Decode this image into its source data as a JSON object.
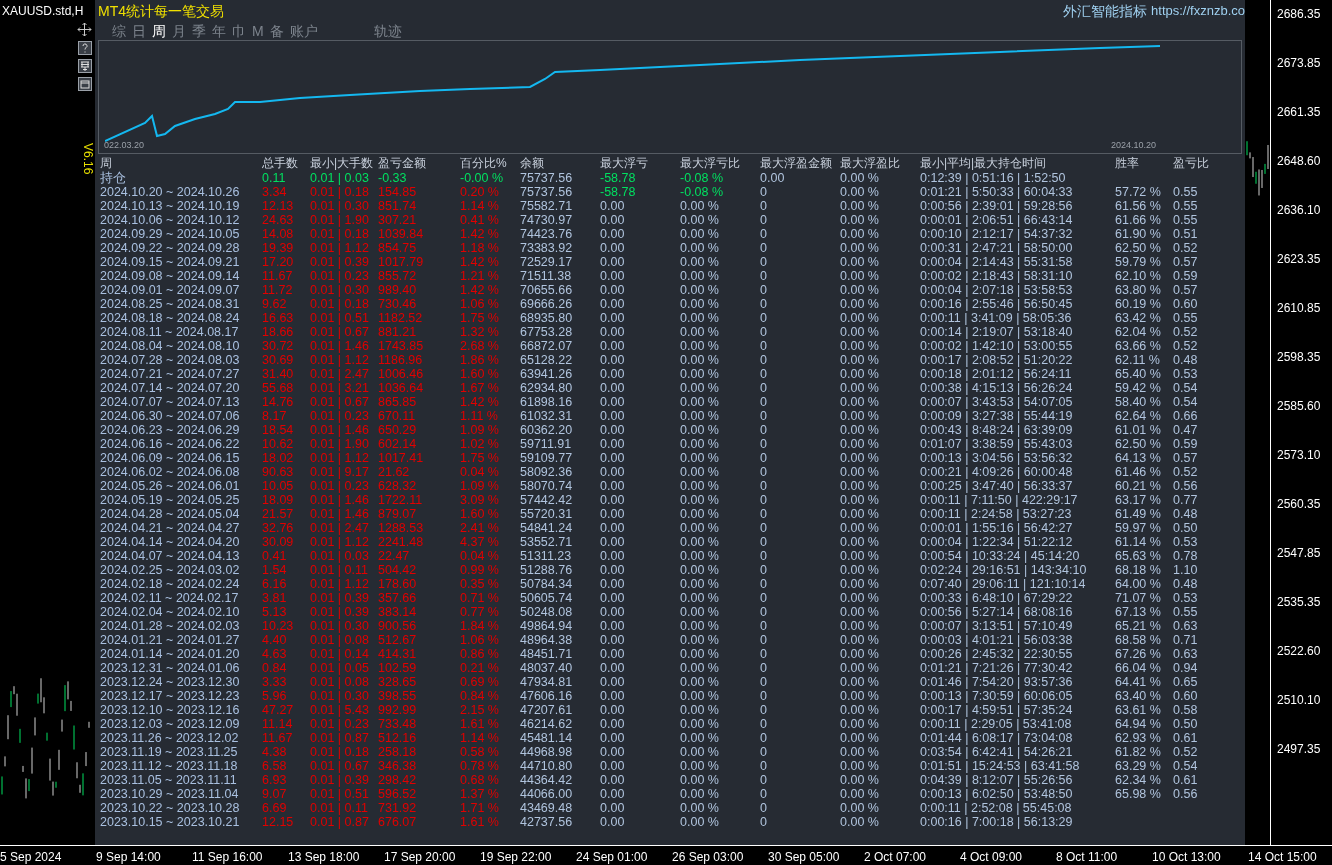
{
  "chart_window": {
    "symbol": "XAUUSD.std,H"
  },
  "panel": {
    "title": "MT4统计每一笔交易",
    "site_name": "外汇智能指标",
    "site_url": "https://fxznzb.co",
    "version": "V6.16",
    "tabs": [
      {
        "label": "综",
        "selected": false
      },
      {
        "label": "日",
        "selected": false
      },
      {
        "label": "周",
        "selected": true
      },
      {
        "label": "月",
        "selected": false
      },
      {
        "label": "季",
        "selected": false
      },
      {
        "label": "年",
        "selected": false
      },
      {
        "label": "巾",
        "selected": false
      },
      {
        "label": "M",
        "selected": false
      },
      {
        "label": "备",
        "selected": false
      },
      {
        "label": "账户",
        "selected": false
      }
    ],
    "track_tab": {
      "label": "轨迹",
      "selected": false
    },
    "equity_curve": {
      "start_label": "022.03.20",
      "end_label": "2024.10.20"
    },
    "table": {
      "columns": [
        "周",
        "总手数",
        "最小|大手数",
        "盈亏金额",
        "百分比%",
        "余额",
        "最大浮亏",
        "最大浮亏比",
        "最大浮盈金额",
        "最大浮盈比",
        "最小|平均|最大持仓时间",
        "胜率",
        "盈亏比"
      ],
      "rows": [
        {
          "kind": "holding",
          "float_highlight": true,
          "cells": [
            "持仓",
            "0.11",
            "0.01 | 0.03",
            "-0.33",
            "-0.00 %",
            "75737.56",
            "-58.78",
            "-0.08 %",
            "0.00",
            "0.00 %",
            "0:12:39 | 0:51:16 | 1:52:50",
            null,
            null
          ]
        },
        {
          "kind": "week",
          "float_highlight": true,
          "cells": [
            "2024.10.20 ~ 2024.10.26",
            "3.34",
            "0.01 | 0.18",
            "154.85",
            "0.20 %",
            "75737.56",
            "-58.78",
            "-0.08 %",
            "0",
            "0.00 %",
            "0:01:21 | 5:50:33 | 60:04:33",
            "57.72 %",
            "0.55"
          ]
        },
        {
          "kind": "week",
          "float_highlight": false,
          "cells": [
            "2024.10.13 ~ 2024.10.19",
            "12.13",
            "0.01 | 0.30",
            "851.74",
            "1.14 %",
            "75582.71",
            "0.00",
            "0.00 %",
            "0",
            "0.00 %",
            "0:00:56 | 2:39:01 | 59:28:56",
            "61.56 %",
            "0.55"
          ]
        },
        {
          "kind": "week",
          "float_highlight": false,
          "cells": [
            "2024.10.06 ~ 2024.10.12",
            "24.63",
            "0.01 | 1.90",
            "307.21",
            "0.41 %",
            "74730.97",
            "0.00",
            "0.00 %",
            "0",
            "0.00 %",
            "0:00:01 | 2:06:51 | 66:43:14",
            "61.66 %",
            "0.55"
          ]
        },
        {
          "kind": "week",
          "float_highlight": false,
          "cells": [
            "2024.09.29 ~ 2024.10.05",
            "14.08",
            "0.01 | 0.18",
            "1039.84",
            "1.42 %",
            "74423.76",
            "0.00",
            "0.00 %",
            "0",
            "0.00 %",
            "0:00:10 | 2:12:17 | 54:37:32",
            "61.90 %",
            "0.51"
          ]
        },
        {
          "kind": "week",
          "float_highlight": false,
          "cells": [
            "2024.09.22 ~ 2024.09.28",
            "19.39",
            "0.01 | 1.12",
            "854.75",
            "1.18 %",
            "73383.92",
            "0.00",
            "0.00 %",
            "0",
            "0.00 %",
            "0:00:31 | 2:47:21 | 58:50:00",
            "62.50 %",
            "0.52"
          ]
        },
        {
          "kind": "week",
          "float_highlight": false,
          "cells": [
            "2024.09.15 ~ 2024.09.21",
            "17.20",
            "0.01 | 0.39",
            "1017.79",
            "1.42 %",
            "72529.17",
            "0.00",
            "0.00 %",
            "0",
            "0.00 %",
            "0:00:04 | 2:14:43 | 55:31:58",
            "59.79 %",
            "0.57"
          ]
        },
        {
          "kind": "week",
          "float_highlight": false,
          "cells": [
            "2024.09.08 ~ 2024.09.14",
            "11.67",
            "0.01 | 0.23",
            "855.72",
            "1.21 %",
            "71511.38",
            "0.00",
            "0.00 %",
            "0",
            "0.00 %",
            "0:00:02 | 2:18:43 | 58:31:10",
            "62.10 %",
            "0.59"
          ]
        },
        {
          "kind": "week",
          "float_highlight": false,
          "cells": [
            "2024.09.01 ~ 2024.09.07",
            "11.72",
            "0.01 | 0.30",
            "989.40",
            "1.42 %",
            "70655.66",
            "0.00",
            "0.00 %",
            "0",
            "0.00 %",
            "0:00:04 | 2:07:18 | 53:58:53",
            "63.80 %",
            "0.57"
          ]
        },
        {
          "kind": "week",
          "float_highlight": false,
          "cells": [
            "2024.08.25 ~ 2024.08.31",
            "9.62",
            "0.01 | 0.18",
            "730.46",
            "1.06 %",
            "69666.26",
            "0.00",
            "0.00 %",
            "0",
            "0.00 %",
            "0:00:16 | 2:55:46 | 56:50:45",
            "60.19 %",
            "0.60"
          ]
        },
        {
          "kind": "week",
          "float_highlight": false,
          "cells": [
            "2024.08.18 ~ 2024.08.24",
            "16.63",
            "0.01 | 0.51",
            "1182.52",
            "1.75 %",
            "68935.80",
            "0.00",
            "0.00 %",
            "0",
            "0.00 %",
            "0:00:11 | 3:41:09 | 58:05:36",
            "63.42 %",
            "0.55"
          ]
        },
        {
          "kind": "week",
          "float_highlight": false,
          "cells": [
            "2024.08.11 ~ 2024.08.17",
            "18.66",
            "0.01 | 0.67",
            "881.21",
            "1.32 %",
            "67753.28",
            "0.00",
            "0.00 %",
            "0",
            "0.00 %",
            "0:00:14 | 2:19:07 | 53:18:40",
            "62.04 %",
            "0.52"
          ]
        },
        {
          "kind": "week",
          "float_highlight": false,
          "cells": [
            "2024.08.04 ~ 2024.08.10",
            "30.72",
            "0.01 | 1.46",
            "1743.85",
            "2.68 %",
            "66872.07",
            "0.00",
            "0.00 %",
            "0",
            "0.00 %",
            "0:00:02 | 1:42:10 | 53:00:55",
            "63.66 %",
            "0.52"
          ]
        },
        {
          "kind": "week",
          "float_highlight": false,
          "cells": [
            "2024.07.28 ~ 2024.08.03",
            "30.69",
            "0.01 | 1.12",
            "1186.96",
            "1.86 %",
            "65128.22",
            "0.00",
            "0.00 %",
            "0",
            "0.00 %",
            "0:00:17 | 2:08:52 | 51:20:22",
            "62.11 %",
            "0.48"
          ]
        },
        {
          "kind": "week",
          "float_highlight": false,
          "cells": [
            "2024.07.21 ~ 2024.07.27",
            "31.40",
            "0.01 | 2.47",
            "1006.46",
            "1.60 %",
            "63941.26",
            "0.00",
            "0.00 %",
            "0",
            "0.00 %",
            "0:00:18 | 2:01:12 | 56:24:11",
            "65.40 %",
            "0.53"
          ]
        },
        {
          "kind": "week",
          "float_highlight": false,
          "cells": [
            "2024.07.14 ~ 2024.07.20",
            "55.68",
            "0.01 | 3.21",
            "1036.64",
            "1.67 %",
            "62934.80",
            "0.00",
            "0.00 %",
            "0",
            "0.00 %",
            "0:00:38 | 4:15:13 | 56:26:24",
            "59.42 %",
            "0.54"
          ]
        },
        {
          "kind": "week",
          "float_highlight": false,
          "cells": [
            "2024.07.07 ~ 2024.07.13",
            "14.76",
            "0.01 | 0.67",
            "865.85",
            "1.42 %",
            "61898.16",
            "0.00",
            "0.00 %",
            "0",
            "0.00 %",
            "0:00:07 | 3:43:53 | 54:07:05",
            "58.40 %",
            "0.54"
          ]
        },
        {
          "kind": "week",
          "float_highlight": false,
          "cells": [
            "2024.06.30 ~ 2024.07.06",
            "8.17",
            "0.01 | 0.23",
            "670.11",
            "1.11 %",
            "61032.31",
            "0.00",
            "0.00 %",
            "0",
            "0.00 %",
            "0:00:09 | 3:27:38 | 55:44:19",
            "62.64 %",
            "0.66"
          ]
        },
        {
          "kind": "week",
          "float_highlight": false,
          "cells": [
            "2024.06.23 ~ 2024.06.29",
            "18.54",
            "0.01 | 1.46",
            "650.29",
            "1.09 %",
            "60362.20",
            "0.00",
            "0.00 %",
            "0",
            "0.00 %",
            "0:00:43 | 8:48:24 | 63:39:09",
            "61.01 %",
            "0.47"
          ]
        },
        {
          "kind": "week",
          "float_highlight": false,
          "cells": [
            "2024.06.16 ~ 2024.06.22",
            "10.62",
            "0.01 | 1.90",
            "602.14",
            "1.02 %",
            "59711.91",
            "0.00",
            "0.00 %",
            "0",
            "0.00 %",
            "0:01:07 | 3:38:59 | 55:43:03",
            "62.50 %",
            "0.59"
          ]
        },
        {
          "kind": "week",
          "float_highlight": false,
          "cells": [
            "2024.06.09 ~ 2024.06.15",
            "18.02",
            "0.01 | 1.12",
            "1017.41",
            "1.75 %",
            "59109.77",
            "0.00",
            "0.00 %",
            "0",
            "0.00 %",
            "0:00:13 | 3:04:56 | 53:56:32",
            "64.13 %",
            "0.57"
          ]
        },
        {
          "kind": "week",
          "float_highlight": false,
          "cells": [
            "2024.06.02 ~ 2024.06.08",
            "90.63",
            "0.01 | 9.17",
            "21.62",
            "0.04 %",
            "58092.36",
            "0.00",
            "0.00 %",
            "0",
            "0.00 %",
            "0:00:21 | 4:09:26 | 60:00:48",
            "61.46 %",
            "0.52"
          ]
        },
        {
          "kind": "week",
          "float_highlight": false,
          "cells": [
            "2024.05.26 ~ 2024.06.01",
            "10.05",
            "0.01 | 0.23",
            "628.32",
            "1.09 %",
            "58070.74",
            "0.00",
            "0.00 %",
            "0",
            "0.00 %",
            "0:00:25 | 3:47:40 | 56:33:37",
            "60.21 %",
            "0.56"
          ]
        },
        {
          "kind": "week",
          "float_highlight": false,
          "cells": [
            "2024.05.19 ~ 2024.05.25",
            "18.09",
            "0.01 | 1.46",
            "1722.11",
            "3.09 %",
            "57442.42",
            "0.00",
            "0.00 %",
            "0",
            "0.00 %",
            "0:00:11 | 7:11:50 | 422:29:17",
            "63.17 %",
            "0.77"
          ]
        },
        {
          "kind": "week",
          "float_highlight": false,
          "cells": [
            "2024.04.28 ~ 2024.05.04",
            "21.57",
            "0.01 | 1.46",
            "879.07",
            "1.60 %",
            "55720.31",
            "0.00",
            "0.00 %",
            "0",
            "0.00 %",
            "0:00:11 | 2:24:58 | 53:27:23",
            "61.49 %",
            "0.48"
          ]
        },
        {
          "kind": "week",
          "float_highlight": false,
          "cells": [
            "2024.04.21 ~ 2024.04.27",
            "32.76",
            "0.01 | 2.47",
            "1288.53",
            "2.41 %",
            "54841.24",
            "0.00",
            "0.00 %",
            "0",
            "0.00 %",
            "0:00:01 | 1:55:16 | 56:42:27",
            "59.97 %",
            "0.50"
          ]
        },
        {
          "kind": "week",
          "float_highlight": false,
          "cells": [
            "2024.04.14 ~ 2024.04.20",
            "30.09",
            "0.01 | 1.12",
            "2241.48",
            "4.37 %",
            "53552.71",
            "0.00",
            "0.00 %",
            "0",
            "0.00 %",
            "0:00:04 | 1:22:34 | 51:22:12",
            "61.14 %",
            "0.53"
          ]
        },
        {
          "kind": "week",
          "float_highlight": false,
          "cells": [
            "2024.04.07 ~ 2024.04.13",
            "0.41",
            "0.01 | 0.03",
            "22.47",
            "0.04 %",
            "51311.23",
            "0.00",
            "0.00 %",
            "0",
            "0.00 %",
            "0:00:54 | 10:33:24 | 45:14:20",
            "65.63 %",
            "0.78"
          ]
        },
        {
          "kind": "week",
          "float_highlight": false,
          "cells": [
            "2024.02.25 ~ 2024.03.02",
            "1.54",
            "0.01 | 0.11",
            "504.42",
            "0.99 %",
            "51288.76",
            "0.00",
            "0.00 %",
            "0",
            "0.00 %",
            "0:02:24 | 29:16:51 | 143:34:10",
            "68.18 %",
            "1.10"
          ]
        },
        {
          "kind": "week",
          "float_highlight": false,
          "cells": [
            "2024.02.18 ~ 2024.02.24",
            "6.16",
            "0.01 | 1.12",
            "178.60",
            "0.35 %",
            "50784.34",
            "0.00",
            "0.00 %",
            "0",
            "0.00 %",
            "0:07:40 | 29:06:11 | 121:10:14",
            "64.00 %",
            "0.48"
          ]
        },
        {
          "kind": "week",
          "float_highlight": false,
          "cells": [
            "2024.02.11 ~ 2024.02.17",
            "3.81",
            "0.01 | 0.39",
            "357.66",
            "0.71 %",
            "50605.74",
            "0.00",
            "0.00 %",
            "0",
            "0.00 %",
            "0:00:33 | 6:48:10 | 67:29:22",
            "71.07 %",
            "0.53"
          ]
        },
        {
          "kind": "week",
          "float_highlight": false,
          "cells": [
            "2024.02.04 ~ 2024.02.10",
            "5.13",
            "0.01 | 0.39",
            "383.14",
            "0.77 %",
            "50248.08",
            "0.00",
            "0.00 %",
            "0",
            "0.00 %",
            "0:00:56 | 5:27:14 | 68:08:16",
            "67.13 %",
            "0.55"
          ]
        },
        {
          "kind": "week",
          "float_highlight": false,
          "cells": [
            "2024.01.28 ~ 2024.02.03",
            "10.23",
            "0.01 | 0.30",
            "900.56",
            "1.84 %",
            "49864.94",
            "0.00",
            "0.00 %",
            "0",
            "0.00 %",
            "0:00:07 | 3:13:51 | 57:10:49",
            "65.21 %",
            "0.63"
          ]
        },
        {
          "kind": "week",
          "float_highlight": false,
          "cells": [
            "2024.01.21 ~ 2024.01.27",
            "4.40",
            "0.01 | 0.08",
            "512.67",
            "1.06 %",
            "48964.38",
            "0.00",
            "0.00 %",
            "0",
            "0.00 %",
            "0:00:03 | 4:01:21 | 56:03:38",
            "68.58 %",
            "0.71"
          ]
        },
        {
          "kind": "week",
          "float_highlight": false,
          "cells": [
            "2024.01.14 ~ 2024.01.20",
            "4.63",
            "0.01 | 0.14",
            "414.31",
            "0.86 %",
            "48451.71",
            "0.00",
            "0.00 %",
            "0",
            "0.00 %",
            "0:00:26 | 2:45:32 | 22:30:55",
            "67.26 %",
            "0.63"
          ]
        },
        {
          "kind": "week",
          "float_highlight": false,
          "cells": [
            "2023.12.31 ~ 2024.01.06",
            "0.84",
            "0.01 | 0.05",
            "102.59",
            "0.21 %",
            "48037.40",
            "0.00",
            "0.00 %",
            "0",
            "0.00 %",
            "0:01:21 | 7:21:26 | 77:30:42",
            "66.04 %",
            "0.94"
          ]
        },
        {
          "kind": "week",
          "float_highlight": false,
          "cells": [
            "2023.12.24 ~ 2023.12.30",
            "3.33",
            "0.01 | 0.08",
            "328.65",
            "0.69 %",
            "47934.81",
            "0.00",
            "0.00 %",
            "0",
            "0.00 %",
            "0:01:46 | 7:54:20 | 93:57:36",
            "64.41 %",
            "0.65"
          ]
        },
        {
          "kind": "week",
          "float_highlight": false,
          "cells": [
            "2023.12.17 ~ 2023.12.23",
            "5.96",
            "0.01 | 0.30",
            "398.55",
            "0.84 %",
            "47606.16",
            "0.00",
            "0.00 %",
            "0",
            "0.00 %",
            "0:00:13 | 7:30:59 | 60:06:05",
            "63.40 %",
            "0.60"
          ]
        },
        {
          "kind": "week",
          "float_highlight": false,
          "cells": [
            "2023.12.10 ~ 2023.12.16",
            "47.27",
            "0.01 | 5.43",
            "992.99",
            "2.15 %",
            "47207.61",
            "0.00",
            "0.00 %",
            "0",
            "0.00 %",
            "0:00:17 | 4:59:51 | 57:35:24",
            "63.61 %",
            "0.58"
          ]
        },
        {
          "kind": "week",
          "float_highlight": false,
          "cells": [
            "2023.12.03 ~ 2023.12.09",
            "11.14",
            "0.01 | 0.23",
            "733.48",
            "1.61 %",
            "46214.62",
            "0.00",
            "0.00 %",
            "0",
            "0.00 %",
            "0:00:11 | 2:29:05 | 53:41:08",
            "64.94 %",
            "0.50"
          ]
        },
        {
          "kind": "week",
          "float_highlight": false,
          "cells": [
            "2023.11.26 ~ 2023.12.02",
            "11.67",
            "0.01 | 0.87",
            "512.16",
            "1.14 %",
            "45481.14",
            "0.00",
            "0.00 %",
            "0",
            "0.00 %",
            "0:01:44 | 6:08:17 | 73:04:08",
            "62.93 %",
            "0.61"
          ]
        },
        {
          "kind": "week",
          "float_highlight": false,
          "cells": [
            "2023.11.19 ~ 2023.11.25",
            "4.38",
            "0.01 | 0.18",
            "258.18",
            "0.58 %",
            "44968.98",
            "0.00",
            "0.00 %",
            "0",
            "0.00 %",
            "0:03:54 | 6:42:41 | 54:26:21",
            "61.82 %",
            "0.52"
          ]
        },
        {
          "kind": "week",
          "float_highlight": false,
          "cells": [
            "2023.11.12 ~ 2023.11.18",
            "6.58",
            "0.01 | 0.67",
            "346.38",
            "0.78 %",
            "44710.80",
            "0.00",
            "0.00 %",
            "0",
            "0.00 %",
            "0:01:51 | 15:24:53 | 63:41:58",
            "63.29 %",
            "0.54"
          ]
        },
        {
          "kind": "week",
          "float_highlight": false,
          "cells": [
            "2023.11.05 ~ 2023.11.11",
            "6.93",
            "0.01 | 0.39",
            "298.42",
            "0.68 %",
            "44364.42",
            "0.00",
            "0.00 %",
            "0",
            "0.00 %",
            "0:04:39 | 8:12:07 | 55:26:56",
            "62.34 %",
            "0.61"
          ]
        },
        {
          "kind": "week",
          "float_highlight": false,
          "cells": [
            "2023.10.29 ~ 2023.11.04",
            "9.07",
            "0.01 | 0.51",
            "596.52",
            "1.37 %",
            "44066.00",
            "0.00",
            "0.00 %",
            "0",
            "0.00 %",
            "0:00:13 | 6:02:50 | 53:48:50",
            "65.98 %",
            "0.56"
          ]
        },
        {
          "kind": "week",
          "float_highlight": false,
          "cells": [
            "2023.10.22 ~ 2023.10.28",
            "6.69",
            "0.01 | 0.11",
            "731.92",
            "1.71 %",
            "43469.48",
            "0.00",
            "0.00 %",
            "0",
            "0.00 %",
            "0:00:11 | 2:52:08 | 55:45:08",
            null,
            null
          ]
        },
        {
          "kind": "week",
          "float_highlight": false,
          "cells": [
            "2023.10.15 ~ 2023.10.21",
            "12.15",
            "0.01 | 0.87",
            "676.07",
            "1.61 %",
            "42737.56",
            "0.00",
            "0.00 %",
            "0",
            "0.00 %",
            "0:00:16 | 7:00:18 | 56:13:29",
            null,
            null
          ]
        }
      ]
    }
  },
  "price_axis": [
    "2686.35",
    "2673.85",
    "2661.35",
    "2648.60",
    "2636.10",
    "2623.35",
    "2610.85",
    "2598.35",
    "2585.60",
    "2573.10",
    "2560.35",
    "2547.85",
    "2535.35",
    "2522.60",
    "2510.10",
    "2497.35"
  ],
  "time_axis": [
    "5 Sep 2024",
    "9 Sep 14:00",
    "11 Sep 16:00",
    "13 Sep 18:00",
    "17 Sep 20:00",
    "19 Sep 22:00",
    "24 Sep 01:00",
    "26 Sep 03:00",
    "30 Sep 05:00",
    "2 Oct 07:00",
    "4 Oct 09:00",
    "8 Oct 11:00",
    "10 Oct 13:00",
    "14 Oct 15:00"
  ]
}
